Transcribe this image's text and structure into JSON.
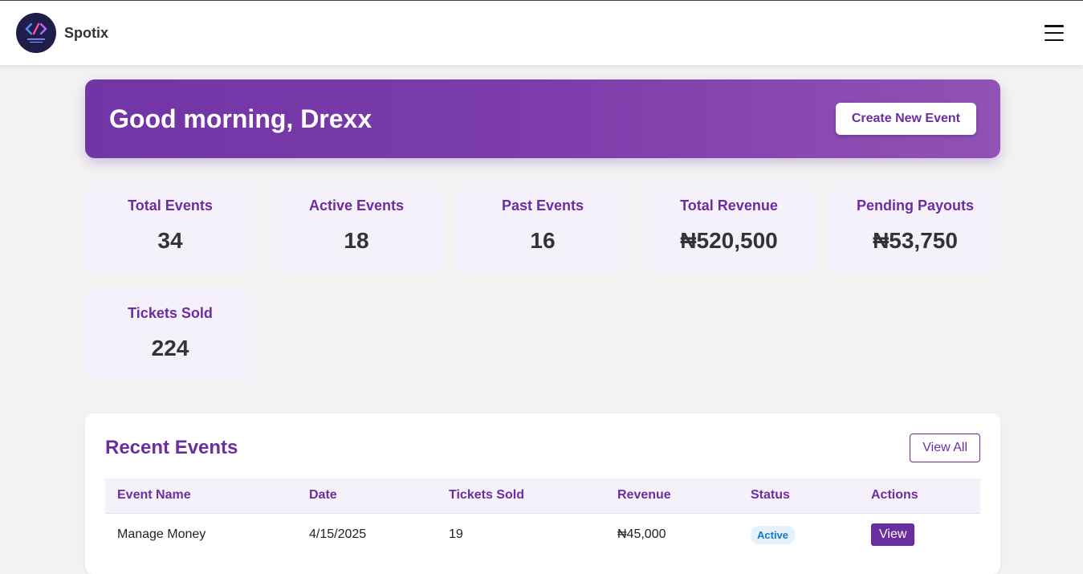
{
  "app": {
    "name": "Spotix"
  },
  "hero": {
    "greeting": "Good morning, Drexx",
    "create_label": "Create New Event"
  },
  "stats": [
    {
      "label": "Total Events",
      "value": "34"
    },
    {
      "label": "Active Events",
      "value": "18"
    },
    {
      "label": "Past Events",
      "value": "16"
    },
    {
      "label": "Total Revenue",
      "value": "₦520,500"
    },
    {
      "label": "Pending Payouts",
      "value": "₦53,750"
    },
    {
      "label": "Tickets Sold",
      "value": "224"
    }
  ],
  "recent": {
    "title": "Recent Events",
    "view_all_label": "View All",
    "columns": [
      "Event Name",
      "Date",
      "Tickets Sold",
      "Revenue",
      "Status",
      "Actions"
    ],
    "rows": [
      {
        "name": "Manage Money",
        "date": "4/15/2025",
        "tickets": "19",
        "revenue": "₦45,000",
        "status": "Active",
        "action": "View"
      }
    ]
  },
  "colors": {
    "brand": "#6c2d9f",
    "hero_start": "#7235a6",
    "hero_end": "#9152b5",
    "status_active": "#1a78c2"
  },
  "icons": {
    "logo": "spotix-logo",
    "menu": "hamburger-menu-icon"
  }
}
